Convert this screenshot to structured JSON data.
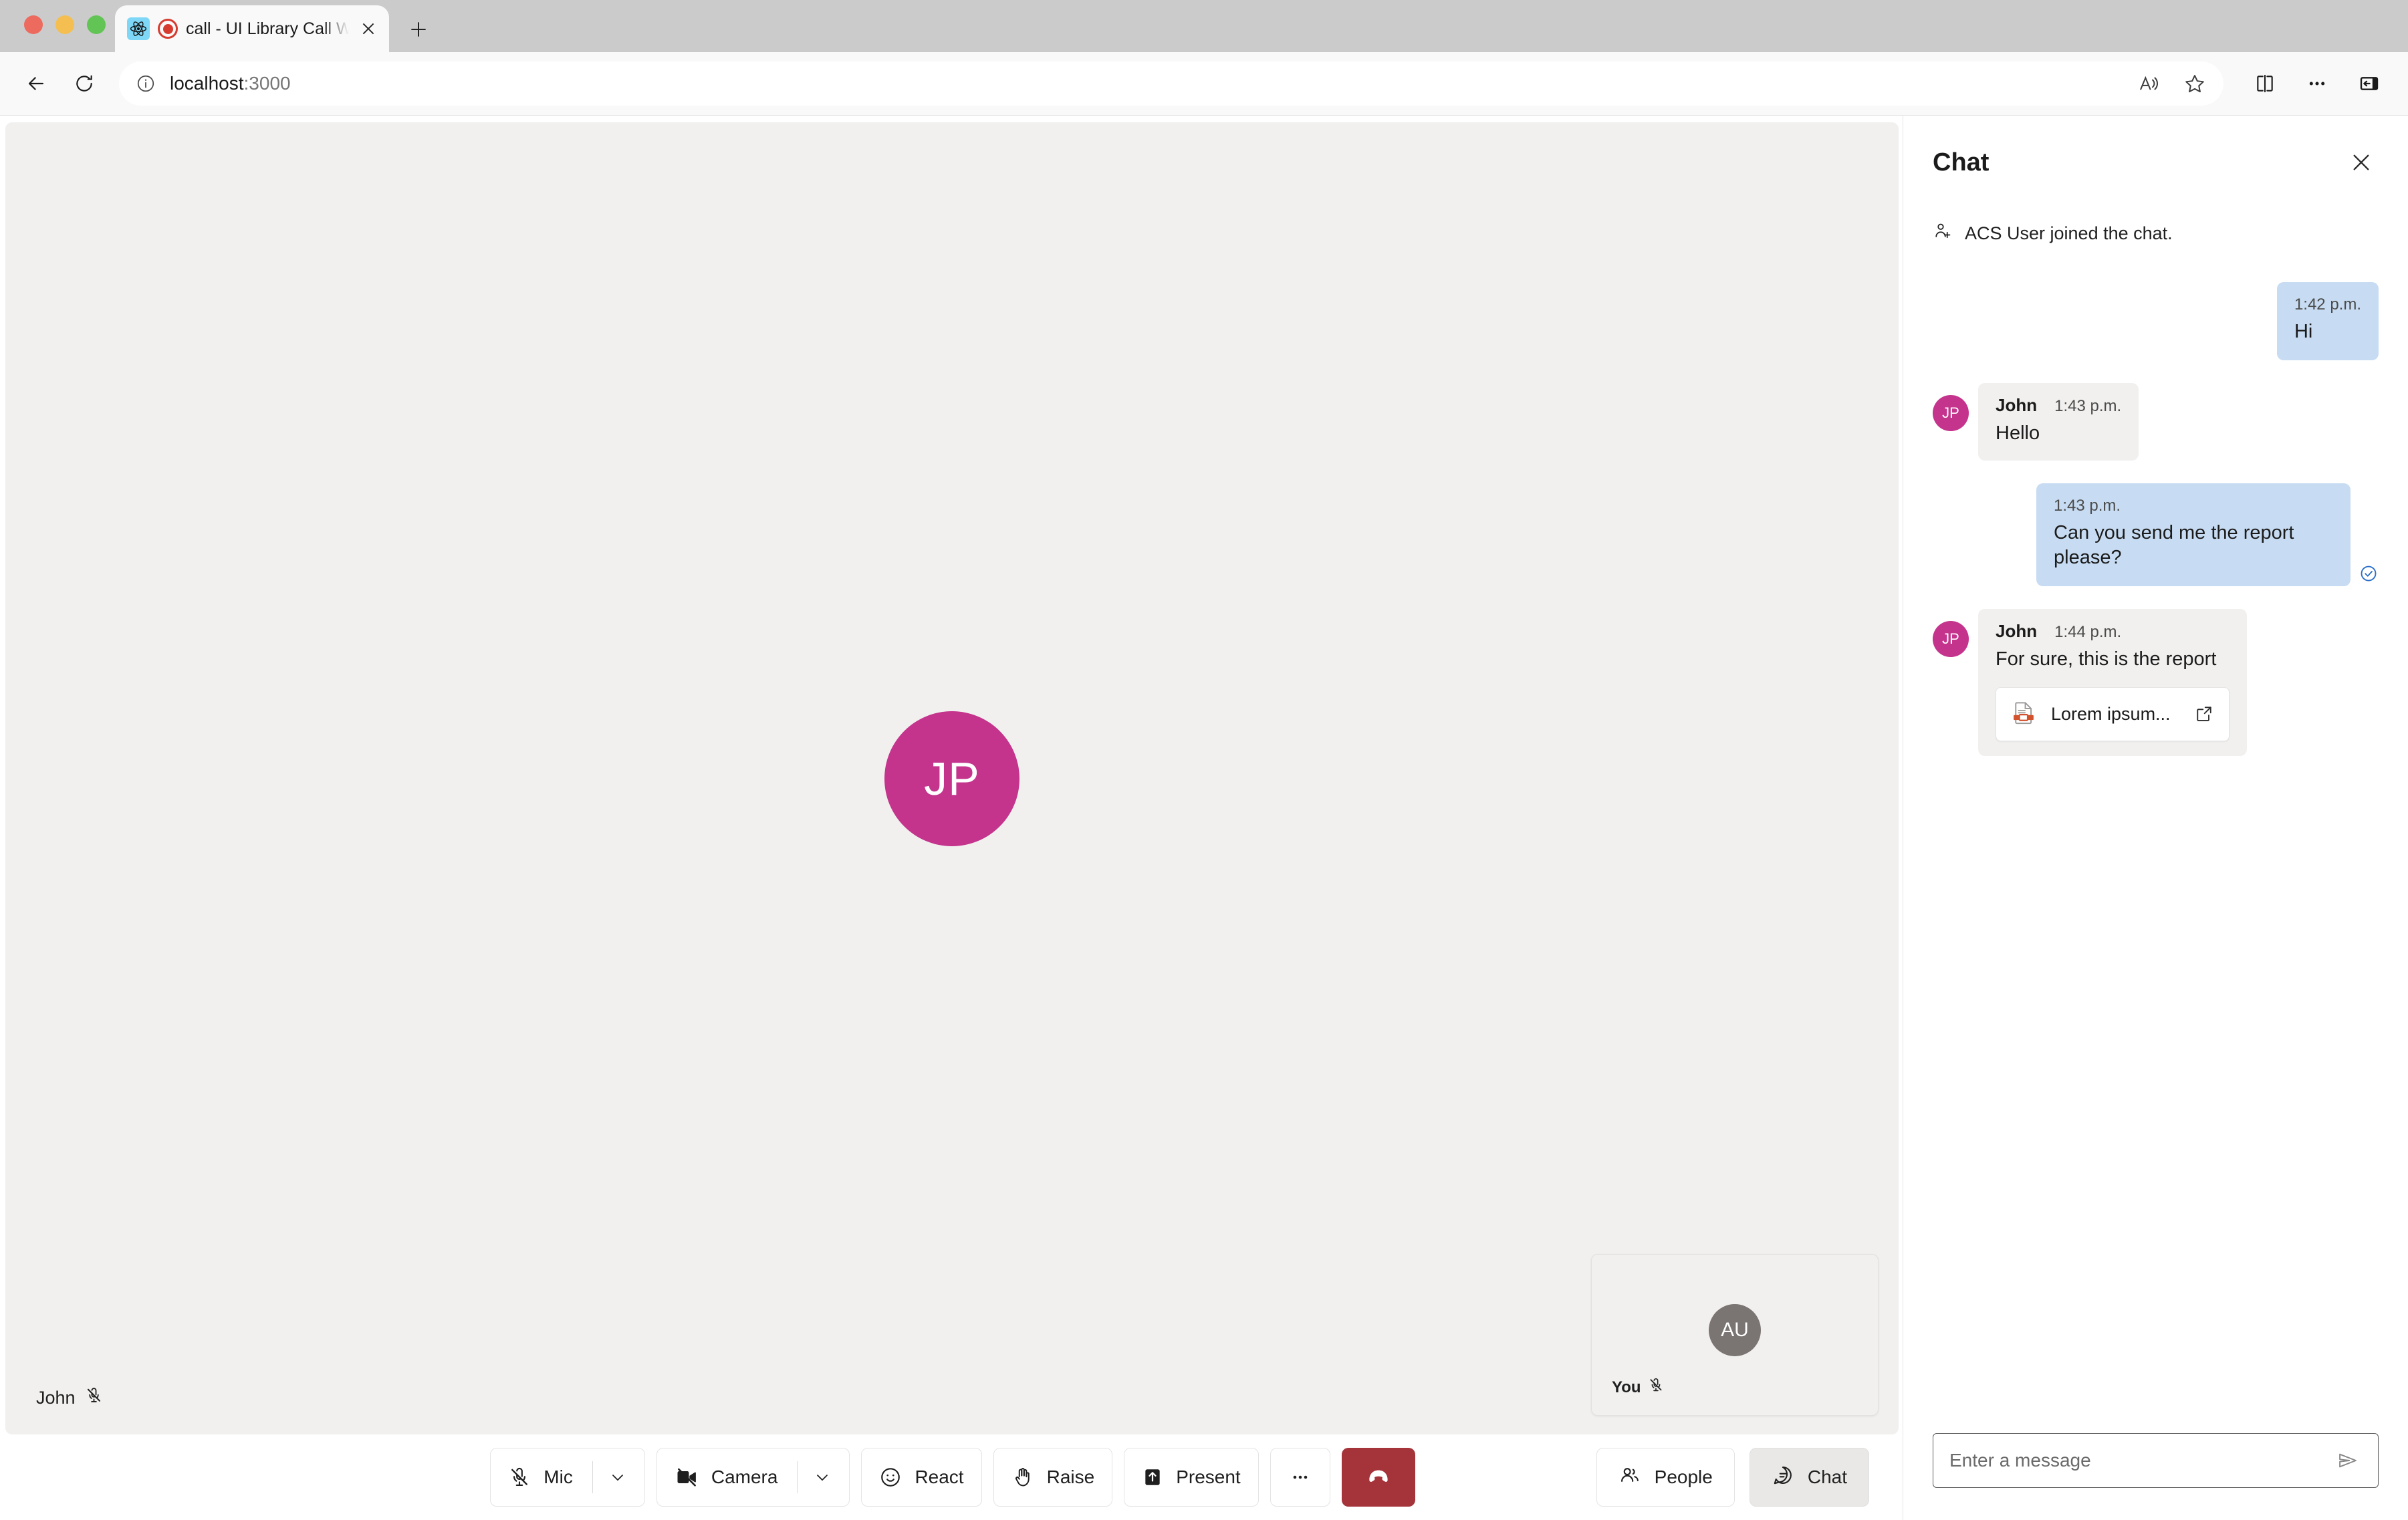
{
  "browser": {
    "tab": {
      "title": "call - UI Library Call With C",
      "favicon": "react-icon",
      "recording_indicator": "record-dot-icon",
      "close": "close-icon"
    },
    "new_tab": "+",
    "nav": {
      "back": "back-arrow-icon",
      "reload": "reload-icon",
      "info": "info-icon",
      "url_host": "localhost",
      "url_port": ":3000",
      "read_aloud": "read-aloud-icon",
      "favorite": "star-icon",
      "split_screen": "split-screen-icon",
      "settings_more": "ellipsis-icon",
      "sidebar": "collections-icon"
    }
  },
  "call": {
    "remote": {
      "initials": "JP",
      "name": "John",
      "muted_icon": "mic-off-icon",
      "avatar_color": "#C4338C"
    },
    "local": {
      "initials": "AU",
      "name": "You",
      "muted_icon": "mic-off-icon",
      "avatar_color": "#7A7572"
    },
    "controls": [
      {
        "label": "Mic",
        "icon": "mic-off-icon",
        "has_menu": true
      },
      {
        "label": "Camera",
        "icon": "camera-off-icon",
        "has_menu": true
      },
      {
        "label": "React",
        "icon": "emoji-icon",
        "has_menu": false
      },
      {
        "label": "Raise",
        "icon": "hand-icon",
        "has_menu": false
      },
      {
        "label": "Present",
        "icon": "share-screen-icon",
        "has_menu": false
      }
    ],
    "more_label": "",
    "more_icon": "ellipsis-icon",
    "end_call": {
      "icon": "hangup-icon",
      "color": "#A4343A"
    },
    "side_buttons": [
      {
        "label": "People",
        "icon": "people-icon",
        "active": false
      },
      {
        "label": "Chat",
        "icon": "chat-bubble-icon",
        "active": true
      }
    ]
  },
  "chat": {
    "title": "Chat",
    "close": "close-icon",
    "system_message": {
      "icon": "person-add-icon",
      "text": "ACS User joined the chat."
    },
    "messages": [
      {
        "side": "out",
        "time": "1:42 p.m.",
        "text": "Hi",
        "read": false
      },
      {
        "side": "in",
        "author": "John",
        "initials": "JP",
        "time": "1:43 p.m.",
        "text": "Hello"
      },
      {
        "side": "out",
        "time": "1:43 p.m.",
        "text": "Can you send me the report please?",
        "read": true,
        "read_icon": "check-circle-icon"
      },
      {
        "side": "in",
        "author": "John",
        "initials": "JP",
        "time": "1:44 p.m.",
        "text": "For sure, this is the report",
        "attachment": {
          "name": "Lorem ipsum...",
          "file_icon": "pdf-file-icon",
          "open_icon": "open-external-icon"
        }
      }
    ],
    "composer": {
      "placeholder": "Enter a message",
      "value": "",
      "send_icon": "send-icon"
    }
  }
}
